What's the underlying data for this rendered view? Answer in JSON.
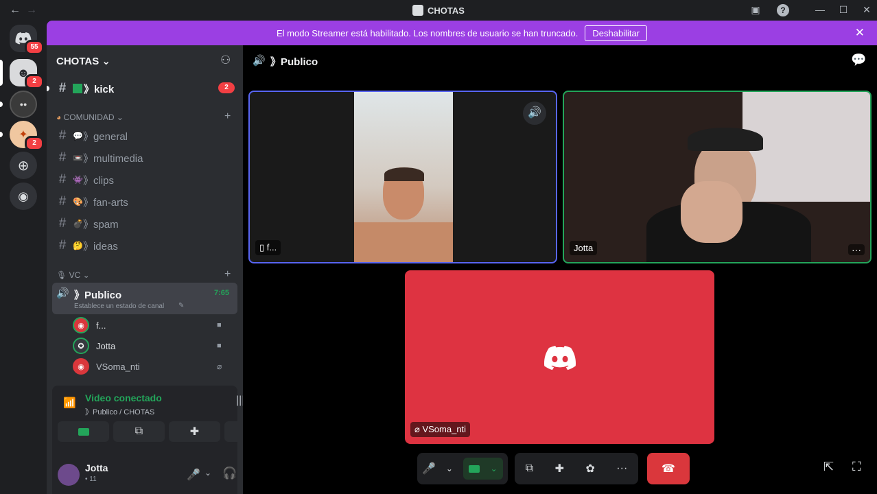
{
  "window": {
    "title": "CHOTAS"
  },
  "banner": {
    "text": "El modo Streamer está habilitado. Los nombres de usuario se han truncado.",
    "button": "Deshabilitar"
  },
  "guilds": {
    "home_badge": "55",
    "badge_2a": "2",
    "badge_2b": "2"
  },
  "server": {
    "name": "CHOTAS ⌄"
  },
  "channels": {
    "top": {
      "name": "》kick",
      "badge": "2"
    },
    "category_comunidad": "COMUNIDAD ⌄",
    "comunidad": [
      {
        "emoji": "💬",
        "name": "》general"
      },
      {
        "emoji": "📼",
        "name": "》multimedia"
      },
      {
        "emoji": "👾",
        "name": "》clips"
      },
      {
        "emoji": "🎨",
        "name": "》fan-arts"
      },
      {
        "emoji": "💣",
        "name": "》spam"
      },
      {
        "emoji": "🤔",
        "name": "》ideas"
      }
    ],
    "category_vc": "VC ⌄",
    "voice": {
      "name": "》Publico",
      "timer": "7:65",
      "status": "Establece un estado de canal"
    },
    "voice_users": [
      {
        "name": "f..."
      },
      {
        "name": "Jotta"
      },
      {
        "name": "VSoma_nti"
      }
    ]
  },
  "connection": {
    "status": "Video conectado",
    "location": "》Publico / CHOTAS"
  },
  "user": {
    "name": "Jotta",
    "status": "• 11"
  },
  "main": {
    "channel": "》Publico"
  },
  "tiles": {
    "tile1_name": "f...",
    "tile2_name": "Jotta",
    "tile3_name": "VSoma_nti"
  },
  "colors": {
    "accent": "#9b3fe3",
    "green": "#23a55a",
    "red": "#da373c",
    "tile_red": "#de3341"
  }
}
